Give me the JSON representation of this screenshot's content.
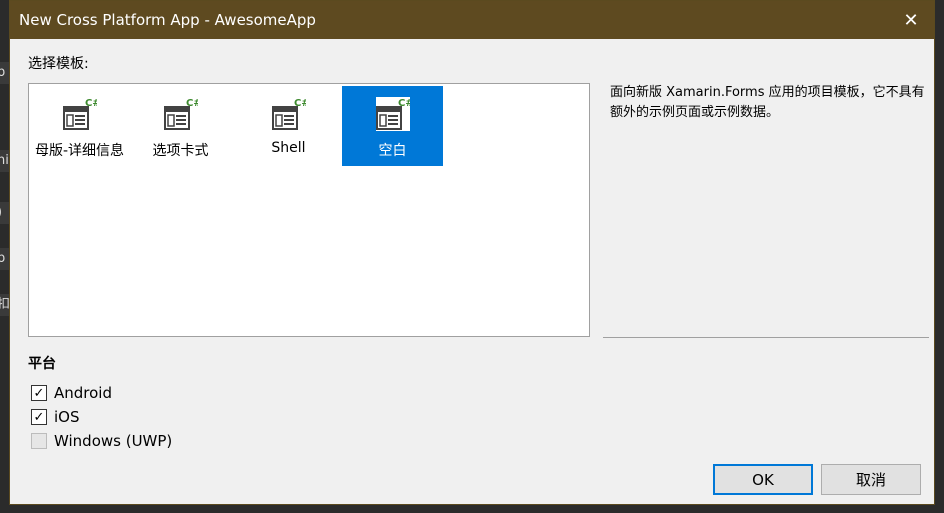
{
  "window": {
    "title": "New Cross Platform App - AwesomeApp",
    "close_glyph": "✕"
  },
  "background_peeks": [
    "p",
    "ni",
    ")",
    "p",
    "扣"
  ],
  "templates": {
    "section_label": "选择模板:",
    "items": [
      {
        "label": "母版-详细信息",
        "icon": "csharp-template-icon",
        "selected": false
      },
      {
        "label": "选项卡式",
        "icon": "csharp-template-icon",
        "selected": false
      },
      {
        "label": "Shell",
        "icon": "csharp-template-icon",
        "selected": false
      },
      {
        "label": "空白",
        "icon": "csharp-template-icon",
        "selected": true
      }
    ]
  },
  "description": "面向新版 Xamarin.Forms 应用的项目模板，它不具有额外的示例页面或示例数据。",
  "platforms": {
    "section_label": "平台",
    "items": [
      {
        "label": "Android",
        "checked": true,
        "enabled": true
      },
      {
        "label": "iOS",
        "checked": true,
        "enabled": true
      },
      {
        "label": "Windows (UWP)",
        "checked": false,
        "enabled": false
      }
    ]
  },
  "buttons": {
    "ok": "OK",
    "cancel": "取消"
  },
  "colors": {
    "titlebar": "#5e4a20",
    "selection": "#0078d7",
    "csharp_badge": "#3d8a2e"
  }
}
